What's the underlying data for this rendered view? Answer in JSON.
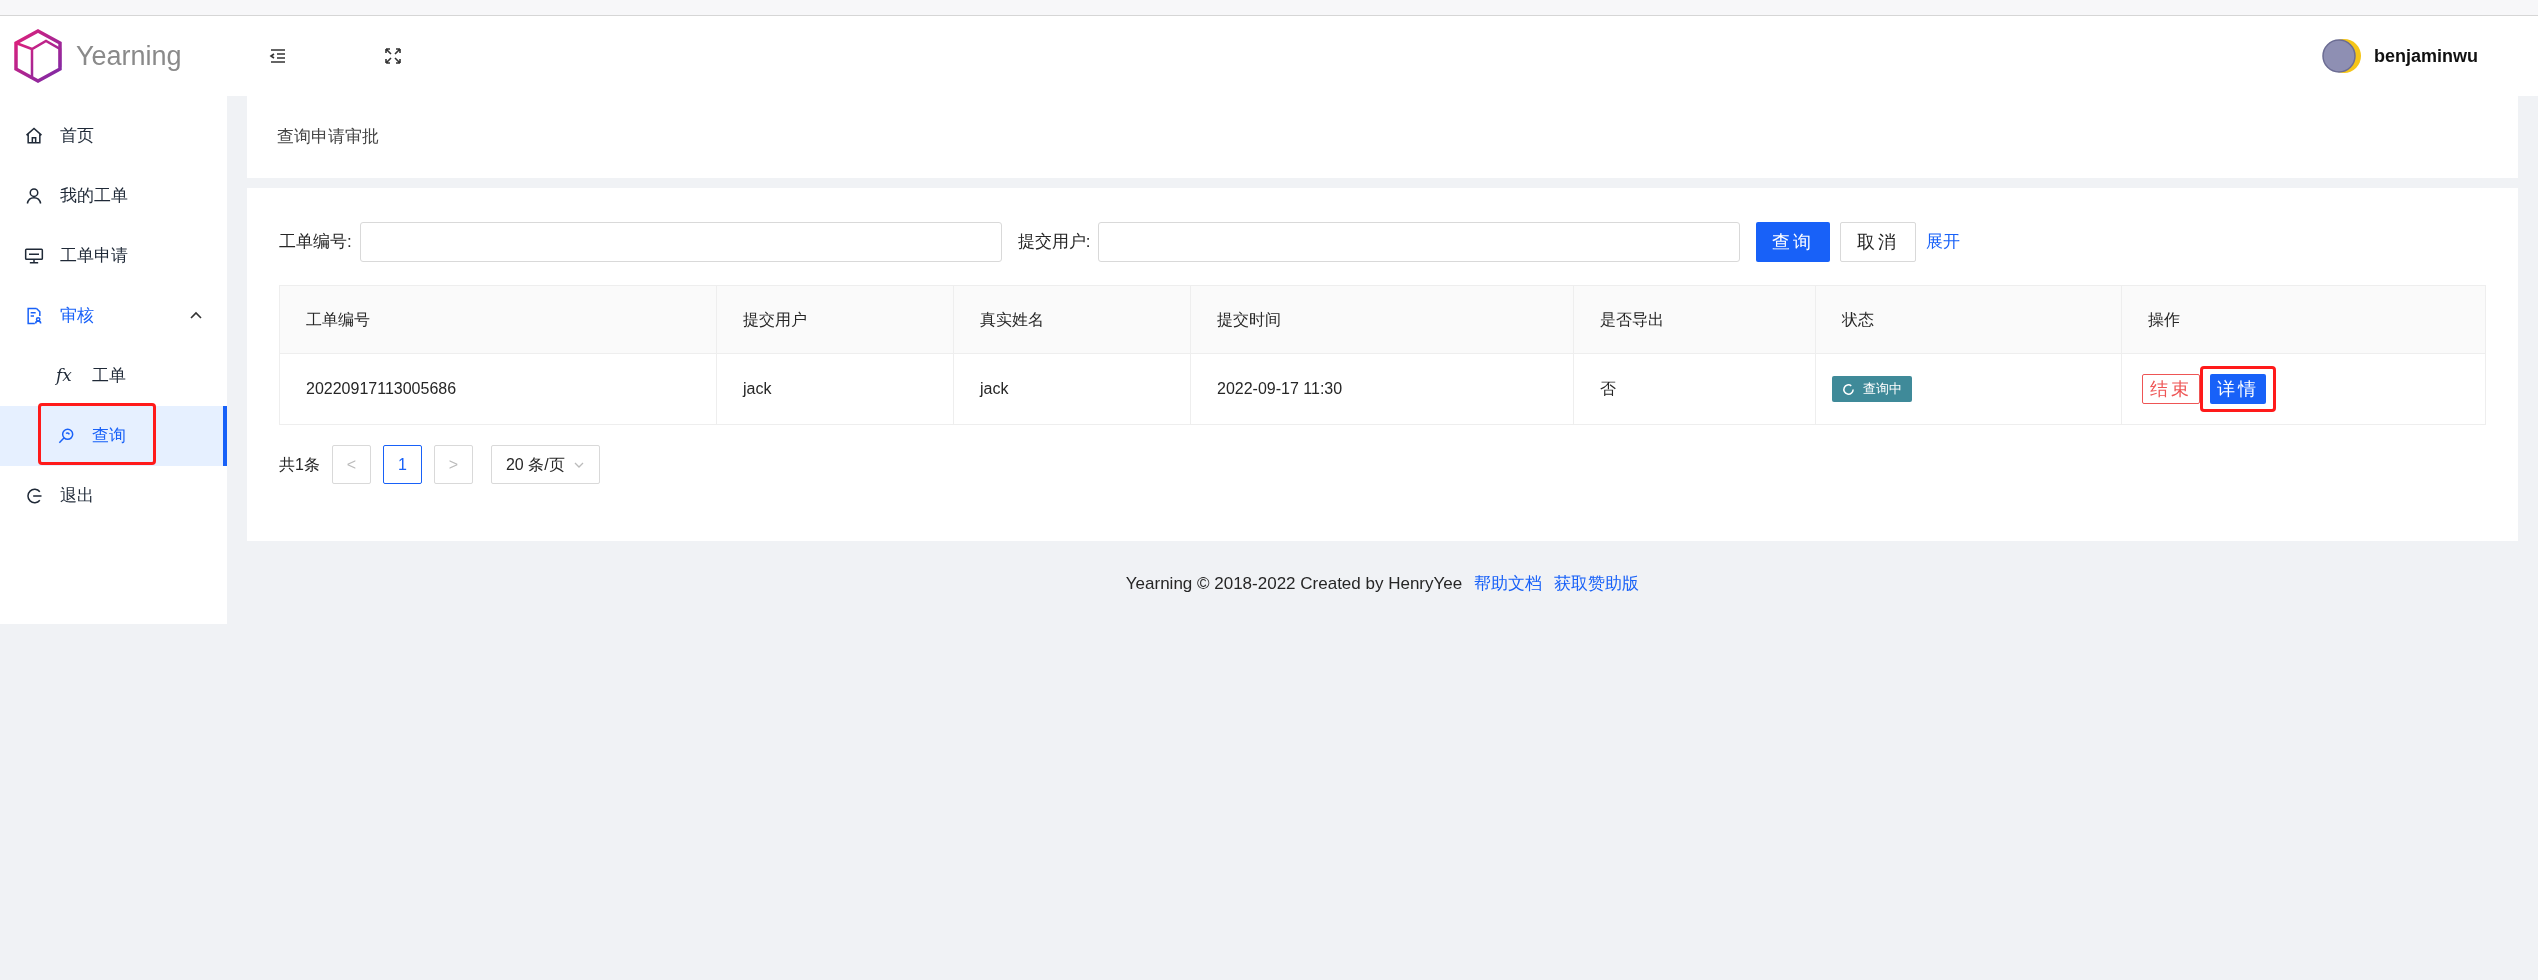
{
  "app": {
    "logo_text": "Yearning"
  },
  "header": {
    "user": "benjaminwu"
  },
  "sidebar": {
    "items": [
      {
        "label": "首页",
        "kind": "home",
        "selected": false
      },
      {
        "label": "我的工单",
        "kind": "user",
        "selected": false
      },
      {
        "label": "工单申请",
        "kind": "sql",
        "selected": false
      },
      {
        "label": "审核",
        "kind": "audit",
        "selected": false,
        "expanded": true,
        "children": [
          {
            "label": "工单",
            "kind": "fx",
            "icon_text": "fx",
            "selected": false,
            "annotated": false
          },
          {
            "label": "查询",
            "kind": "search",
            "selected": true,
            "annotated": true
          }
        ]
      },
      {
        "label": "退出",
        "kind": "logout",
        "selected": false
      }
    ]
  },
  "page": {
    "subtitle": "查询申请审批"
  },
  "filters": [
    {
      "label": "工单编号:"
    },
    {
      "label": "提交用户:"
    }
  ],
  "filter_buttons": [
    {
      "label": "查询",
      "kind": "primary"
    },
    {
      "label": "取消",
      "kind": "default"
    },
    {
      "label": "展开",
      "kind": "link"
    }
  ],
  "table": {
    "columns": [
      "工单编号",
      "提交用户",
      "真实姓名",
      "提交时间",
      "是否导出",
      "状态",
      "操作"
    ],
    "rows": [
      {
        "cells": [
          "20220917113005686",
          "jack",
          "jack",
          "2022-09-17 11:30",
          "否"
        ],
        "status": "查询中",
        "actions": [
          {
            "label": "结束",
            "kind": "danger",
            "annotated": false
          },
          {
            "label": "详情",
            "kind": "primary",
            "annotated": true
          }
        ]
      }
    ]
  },
  "pagination": {
    "total": "共1条",
    "prev": "<",
    "pages": [
      {
        "label": "1",
        "selected": true
      }
    ],
    "next": ">",
    "page_size": "20 条/页"
  },
  "footer": {
    "text": "Yearning © 2018-2022 Created by HenryYee",
    "links": [
      "帮助文档",
      "获取赞助版"
    ]
  }
}
